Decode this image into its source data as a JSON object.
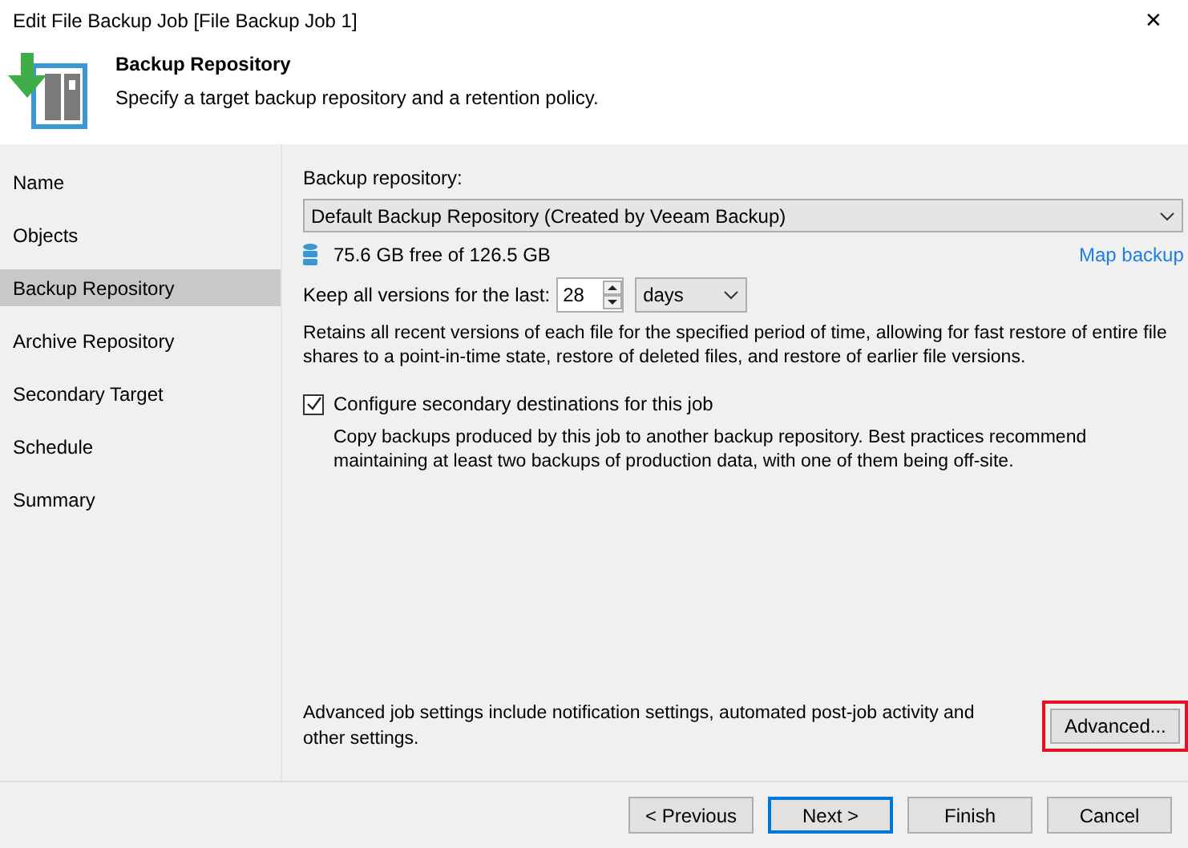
{
  "window": {
    "title": "Edit File Backup Job [File Backup Job 1]",
    "close": "✕"
  },
  "header": {
    "title": "Backup Repository",
    "subtitle": "Specify a target backup repository and a retention policy."
  },
  "sidebar": {
    "items": [
      {
        "label": "Name",
        "selected": false
      },
      {
        "label": "Objects",
        "selected": false
      },
      {
        "label": "Backup Repository",
        "selected": true
      },
      {
        "label": "Archive Repository",
        "selected": false
      },
      {
        "label": "Secondary Target",
        "selected": false
      },
      {
        "label": "Schedule",
        "selected": false
      },
      {
        "label": "Summary",
        "selected": false
      }
    ]
  },
  "repository": {
    "label": "Backup repository:",
    "value": "Default Backup Repository (Created by Veeam Backup)",
    "free_space": "75.6 GB free of 126.5 GB",
    "map_link": "Map backup"
  },
  "retention": {
    "label": "Keep all versions for the last:",
    "value": "28",
    "unit": "days",
    "description": "Retains all recent versions of each file for the specified period of time, allowing for fast restore of entire file shares to a point-in-time state, restore of deleted files, and restore of earlier file versions."
  },
  "secondary": {
    "label": "Configure secondary destinations for this job",
    "checked": true,
    "description": "Copy backups produced by this job to another backup repository. Best practices recommend maintaining at least two backups of production data, with one of them being off-site."
  },
  "advanced": {
    "description": "Advanced job settings include notification settings, automated post-job activity and other settings.",
    "button": "Advanced...",
    "highlighted": true
  },
  "buttons": [
    {
      "label": "< Previous",
      "focused": false
    },
    {
      "label": "Next >",
      "focused": true
    },
    {
      "label": "Finish",
      "focused": false
    },
    {
      "label": "Cancel",
      "focused": false
    }
  ]
}
